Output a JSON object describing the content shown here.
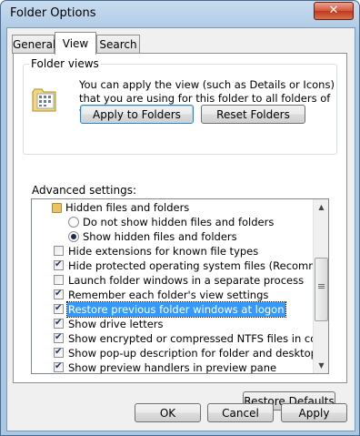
{
  "window": {
    "title": "Folder Options"
  },
  "tabs": [
    {
      "label": "General"
    },
    {
      "label": "View"
    },
    {
      "label": "Search"
    }
  ],
  "folder_views": {
    "caption": "Folder views",
    "description": "You can apply the view (such as Details or Icons) that you are using for this folder to all folders of this type.",
    "apply_label": "Apply to Folders",
    "reset_label": "Reset Folders"
  },
  "advanced": {
    "label": "Advanced settings:",
    "items": [
      {
        "type": "folder",
        "label": "Hidden files and folders"
      },
      {
        "type": "radio",
        "checked": false,
        "label": "Do not show hidden files and folders"
      },
      {
        "type": "radio",
        "checked": true,
        "label": "Show hidden files and folders"
      },
      {
        "type": "checkbox",
        "checked": false,
        "label": "Hide extensions for known file types"
      },
      {
        "type": "checkbox",
        "checked": true,
        "label": "Hide protected operating system files (Recommended)"
      },
      {
        "type": "checkbox",
        "checked": false,
        "label": "Launch folder windows in a separate process"
      },
      {
        "type": "checkbox",
        "checked": true,
        "label": "Remember each folder's view settings"
      },
      {
        "type": "checkbox",
        "checked": true,
        "label": "Restore previous folder windows at logon",
        "selected": true
      },
      {
        "type": "checkbox",
        "checked": true,
        "label": "Show drive letters"
      },
      {
        "type": "checkbox",
        "checked": true,
        "label": "Show encrypted or compressed NTFS files in color"
      },
      {
        "type": "checkbox",
        "checked": true,
        "label": "Show pop-up description for folder and desktop items"
      },
      {
        "type": "checkbox",
        "checked": true,
        "label": "Show preview handlers in preview pane"
      }
    ],
    "restore_defaults_label": "Restore Defaults"
  },
  "footer": {
    "ok_label": "OK",
    "cancel_label": "Cancel",
    "apply_label": "Apply"
  },
  "colors": {
    "close_button": "#c0381b",
    "selection": "#3399ff",
    "frame": "#a9c6e3"
  },
  "icons": {
    "close": "close-icon",
    "folder_views": "folder-views-icon",
    "folder": "folder-icon",
    "scroll_up": "scroll-up-arrow-icon",
    "scroll_down": "scroll-down-arrow-icon"
  }
}
